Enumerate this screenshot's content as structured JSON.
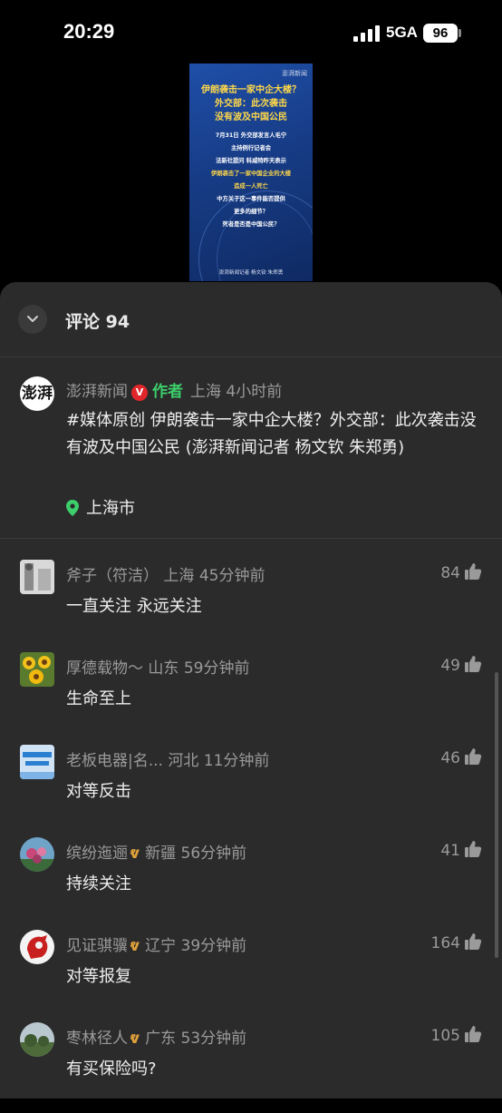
{
  "status": {
    "time": "20:29",
    "network": "5GA",
    "battery": "96"
  },
  "poster": {
    "logo": "澎湃新闻",
    "title_lines": [
      "伊朗袭击一家中企大楼？",
      "外交部：此次袭击",
      "没有波及中国公民"
    ],
    "body_lines": [
      "7月31日 外交部发言人毛宁",
      "主持例行记者会",
      "法新社提问 科威特昨天表示",
      "伊朗袭击了一家中国企业的大楼",
      "造成一人死亡",
      "中方关于这一事件能否提供",
      "更多的细节？",
      "死者是否是中国公民？"
    ],
    "footer": "澎湃新闻记者 杨文钦 朱郑勇"
  },
  "header": {
    "title": "评论 94"
  },
  "author_post": {
    "avatar_text": "澎湃",
    "name": "澎湃新闻",
    "badge": "V",
    "tag": "作者",
    "meta": "上海 4小时前",
    "text": "#媒体原创 伊朗袭击一家中企大楼？外交部：此次袭击没有波及中国公民 (澎湃新闻记者 杨文钦 朱郑勇)",
    "location": "上海市"
  },
  "comments": [
    {
      "name": "斧子（符洁）",
      "region": "上海",
      "time": "45分钟前",
      "text": "一直关注 永远关注",
      "likes": "84"
    },
    {
      "name": "厚德载物～",
      "region": "山东",
      "time": "59分钟前",
      "text": "生命至上",
      "likes": "49"
    },
    {
      "name": "老板电器|名...",
      "region": "河北",
      "time": "11分钟前",
      "text": "对等反击",
      "likes": "46"
    },
    {
      "name": "缤纷迤逦",
      "region": "新疆",
      "time": "56分钟前",
      "text": "持续关注",
      "likes": "41"
    },
    {
      "name": "见证骐骥",
      "region": "辽宁",
      "time": "39分钟前",
      "text": "对等报复",
      "likes": "164"
    },
    {
      "name": "枣林径人",
      "region": "广东",
      "time": "53分钟前",
      "text": "有买保险吗?",
      "likes": "105"
    }
  ],
  "colors": {
    "accent_green": "#3ccf6b",
    "verified_red": "#e0262b",
    "sheet_bg": "#2b2b2b",
    "muted_text": "#9a9a9a"
  }
}
